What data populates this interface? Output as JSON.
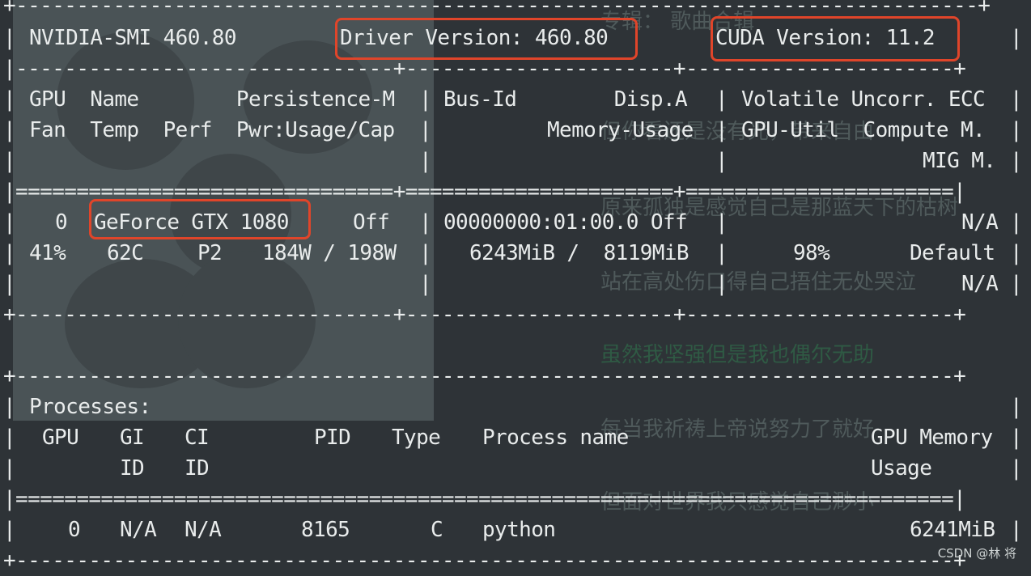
{
  "smi": {
    "name": "NVIDIA-SMI 460.80",
    "driver": "Driver Version: 460.80",
    "cuda": "CUDA Version: 11.2"
  },
  "gpu_header": {
    "c1r1": "GPU  Name        Persistence-M",
    "c1r2": "Fan  Temp  Perf  Pwr:Usage/Cap",
    "c2r1": "Bus-Id        Disp.A",
    "c2r2": "Memory-Usage",
    "c3r1": "Volatile Uncorr. ECC",
    "c3r2": "GPU-Util  Compute M.",
    "c3r3": "MIG M."
  },
  "gpu_row": {
    "index": "0",
    "name": "GeForce GTX 1080",
    "persistence": "Off",
    "bus_disp": "00000000:01:00.0 Off",
    "ecc": "N/A",
    "fan": "41%",
    "temp": "62C",
    "perf": "P2",
    "power": "184W / 198W",
    "memory": "6243MiB /  8119MiB",
    "util": "98%",
    "compute": "Default",
    "mig": "N/A"
  },
  "processes": {
    "title": "Processes:",
    "h_gpu": "GPU",
    "h_gi": "GI",
    "h_ci": "CI",
    "h_gi2": "ID",
    "h_ci2": "ID",
    "h_pid": "PID",
    "h_type": "Type",
    "h_name": "Process name",
    "h_mem": "GPU Memory",
    "h_mem2": "Usage",
    "row": {
      "gpu": "0",
      "gi": "N/A",
      "ci": "N/A",
      "pid": "8165",
      "type": "C",
      "name": "python",
      "mem": "6241MiB"
    }
  },
  "border": {
    "dash": "+-----------------------------------------------+----------------------+----------------------+",
    "eq": "|===============================+======================+======================|",
    "full_dash": "+-----------------------------------------------------------------------------+",
    "full_eq": "|=============================================================================|"
  },
  "ghost_lyrics": [
    "专辑：  歌曲合辑",
    "但你看还是没有光，带来自由",
    "原来孤独是感觉自己是那蓝天下的枯树",
    "站在高处伤口得自己捂住无处哭泣",
    "虽然我坚强但是我也偶尔无助",
    "每当我祈祷上帝说努力了就好",
    "但面对世界我只感觉自己渺小"
  ],
  "watermark": "CSDN @林 将"
}
